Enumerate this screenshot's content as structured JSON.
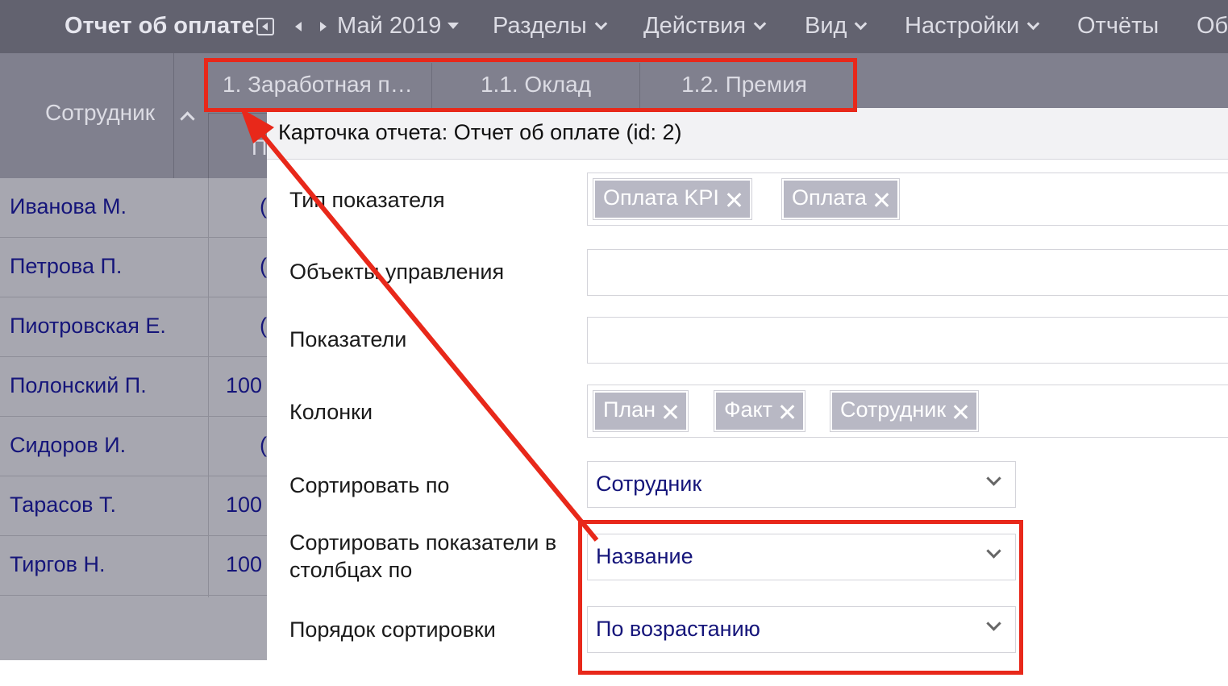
{
  "topbar": {
    "title": "Отчет об оплате",
    "period": "Май 2019",
    "menu": [
      "Разделы",
      "Действия",
      "Вид",
      "Настройки",
      "Отчёты",
      "Об"
    ]
  },
  "tabs": [
    "1. Заработная п…",
    "1.1. Оклад",
    "1.2. Премия"
  ],
  "grid": {
    "employee_header": "Сотрудник",
    "sub_header_letter": "П",
    "rows": [
      {
        "name": "Иванова М.",
        "value": "("
      },
      {
        "name": "Петрова П.",
        "value": "("
      },
      {
        "name": "Пиотровская Е.",
        "value": "("
      },
      {
        "name": "Полонский П.",
        "value": "100"
      },
      {
        "name": "Сидоров И.",
        "value": "("
      },
      {
        "name": "Тарасов Т.",
        "value": "100"
      },
      {
        "name": "Тиргов Н.",
        "value": "100"
      }
    ]
  },
  "modal": {
    "title": "Карточка отчета: Отчет об оплате (id: 2)",
    "fields": {
      "indicator_type_label": "Тип показателя",
      "indicator_type_chips": [
        "Оплата KPI",
        "Оплата"
      ],
      "control_objects_label": "Объекты управления",
      "indicators_label": "Показатели",
      "columns_label": "Колонки",
      "columns_chips": [
        "План",
        "Факт",
        "Сотрудник"
      ],
      "sort_by_label": "Сортировать по",
      "sort_by_value": "Сотрудник",
      "sort_indicators_label_line1": "Сортировать показатели в",
      "sort_indicators_label_line2": "столбцах по",
      "sort_indicators_value": "Название",
      "sort_order_label": "Порядок сортировки",
      "sort_order_value": "По возрастанию"
    }
  },
  "colors": {
    "topbar": "#62626f",
    "grid_header": "#80808e",
    "rows_bg": "#a7a7b0",
    "link_text": "#15157a",
    "chip": "#b8b8c4",
    "annotation_red": "#e8281a"
  }
}
